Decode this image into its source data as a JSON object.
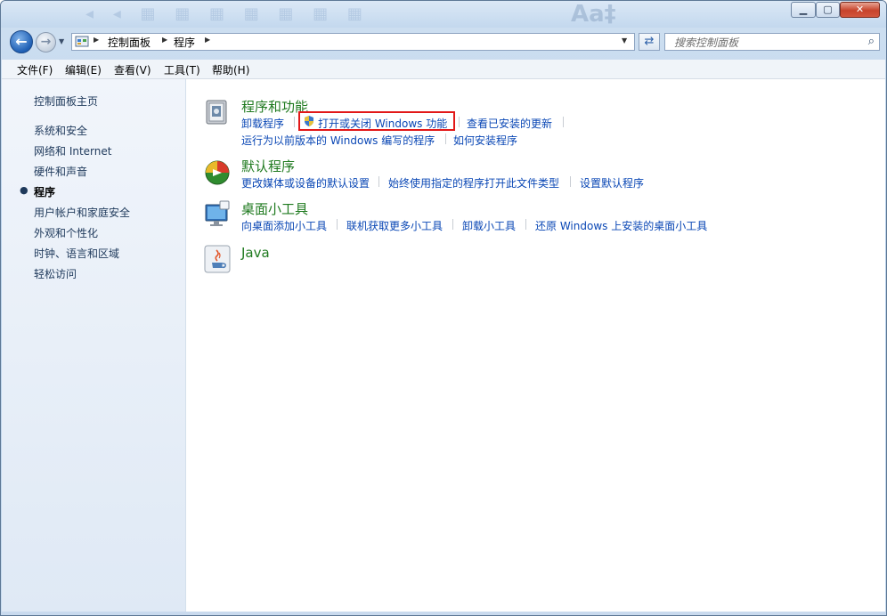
{
  "window": {
    "controls": {
      "minimize": "▁",
      "maximize": "▢",
      "close": "✕"
    }
  },
  "address": {
    "breadcrumb": [
      "控制面板",
      "程序"
    ]
  },
  "search": {
    "placeholder": "搜索控制面板"
  },
  "menubar": {
    "items": [
      "文件(F)",
      "编辑(E)",
      "查看(V)",
      "工具(T)",
      "帮助(H)"
    ]
  },
  "sidebar": {
    "home": "控制面板主页",
    "items": [
      "系统和安全",
      "网络和 Internet",
      "硬件和声音",
      "程序",
      "用户帐户和家庭安全",
      "外观和个性化",
      "时钟、语言和区域",
      "轻松访问"
    ],
    "current": "程序"
  },
  "categories": [
    {
      "title": "程序和功能",
      "icon": "programs-features-icon",
      "links": [
        "卸载程序",
        "打开或关闭 Windows 功能",
        "查看已安装的更新",
        "运行为以前版本的 Windows 编写的程序",
        "如何安装程序"
      ]
    },
    {
      "title": "默认程序",
      "icon": "default-programs-icon",
      "links": [
        "更改媒体或设备的默认设置",
        "始终使用指定的程序打开此文件类型",
        "设置默认程序"
      ]
    },
    {
      "title": "桌面小工具",
      "icon": "desktop-gadgets-icon",
      "links": [
        "向桌面添加小工具",
        "联机获取更多小工具",
        "卸载小工具",
        "还原 Windows 上安装的桌面小工具"
      ]
    },
    {
      "title": "Java",
      "icon": "java-icon",
      "links": []
    }
  ],
  "colors": {
    "link": "#0a47b5",
    "category_title": "#1f7a1f",
    "highlight_border": "#e21818"
  }
}
